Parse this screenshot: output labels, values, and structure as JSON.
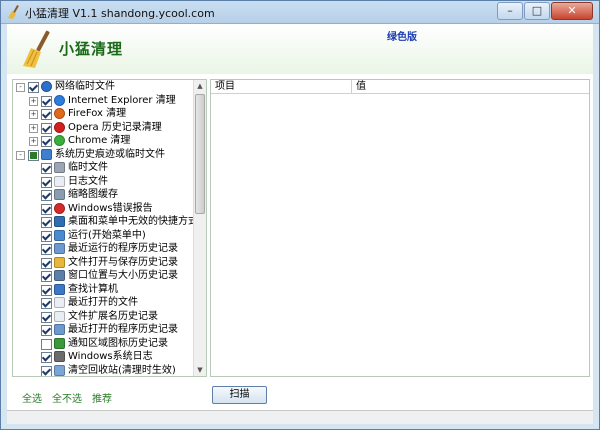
{
  "window": {
    "title": "小猛清理 V1.1 shandong.ycool.com",
    "minimize_label": "–",
    "maximize_label": "□",
    "close_label": "✕"
  },
  "header": {
    "app_name": "小猛清理",
    "edition": "绿色版"
  },
  "tree": {
    "items": [
      {
        "label": "网络临时文件",
        "level": 0,
        "expander": "-",
        "check": "checked",
        "icon": "globe-icon",
        "icon_color": "#2a6fc9"
      },
      {
        "label": "Internet Explorer 清理",
        "level": 1,
        "expander": "+",
        "check": "checked",
        "icon": "ie-icon",
        "icon_color": "#2d7de0"
      },
      {
        "label": "FireFox 清理",
        "level": 1,
        "expander": "+",
        "check": "checked",
        "icon": "firefox-icon",
        "icon_color": "#e06a1a"
      },
      {
        "label": "Opera 历史记录清理",
        "level": 1,
        "expander": "+",
        "check": "checked",
        "icon": "opera-icon",
        "icon_color": "#d22020"
      },
      {
        "label": "Chrome 清理",
        "level": 1,
        "expander": "+",
        "check": "checked",
        "icon": "chrome-icon",
        "icon_color": "#3cae3c"
      },
      {
        "label": "系统历史痕迹或临时文件",
        "level": 0,
        "expander": "-",
        "check": "partial",
        "icon": "windows-icon",
        "icon_color": "#3f7fd0"
      },
      {
        "label": "临时文件",
        "level": 1,
        "expander": "",
        "check": "checked",
        "icon": "file-icon",
        "icon_color": "#9aa6b3"
      },
      {
        "label": "日志文件",
        "level": 1,
        "expander": "",
        "check": "checked",
        "icon": "doc-icon",
        "icon_color": "#e9eef4"
      },
      {
        "label": "缩略图缓存",
        "level": 1,
        "expander": "",
        "check": "checked",
        "icon": "thumbnail-icon",
        "icon_color": "#8a9db0"
      },
      {
        "label": "Windows错误报告",
        "level": 1,
        "expander": "",
        "check": "checked",
        "icon": "error-icon",
        "icon_color": "#d42a2a"
      },
      {
        "label": "桌面和菜单中无效的快捷方式",
        "level": 1,
        "expander": "",
        "check": "checked",
        "icon": "desktop-icon",
        "icon_color": "#2f6fb0"
      },
      {
        "label": "运行(开始菜单中)",
        "level": 1,
        "expander": "",
        "check": "checked",
        "icon": "run-icon",
        "icon_color": "#4a8ad0"
      },
      {
        "label": "最近运行的程序历史记录",
        "level": 1,
        "expander": "",
        "check": "checked",
        "icon": "program-icon",
        "icon_color": "#6a9ad0"
      },
      {
        "label": "文件打开与保存历史记录",
        "level": 1,
        "expander": "",
        "check": "checked",
        "icon": "folder-icon",
        "icon_color": "#e7b73b"
      },
      {
        "label": "窗口位置与大小历史记录",
        "level": 1,
        "expander": "",
        "check": "checked",
        "icon": "window-icon",
        "icon_color": "#5b7fa8"
      },
      {
        "label": "查找计算机",
        "level": 1,
        "expander": "",
        "check": "checked",
        "icon": "search-computer-icon",
        "icon_color": "#3a78c8"
      },
      {
        "label": "最近打开的文件",
        "level": 1,
        "expander": "",
        "check": "checked",
        "icon": "recent-file-icon",
        "icon_color": "#e9eef4"
      },
      {
        "label": "文件扩展名历史记录",
        "level": 1,
        "expander": "",
        "check": "checked",
        "icon": "extension-icon",
        "icon_color": "#e9eef4"
      },
      {
        "label": "最近打开的程序历史记录",
        "level": 1,
        "expander": "",
        "check": "checked",
        "icon": "program-icon",
        "icon_color": "#6a9ad0"
      },
      {
        "label": "通知区域图标历史记录",
        "level": 1,
        "expander": "",
        "check": "unchecked",
        "icon": "tray-icon",
        "icon_color": "#3a9a3a"
      },
      {
        "label": "Windows系统日志",
        "level": 1,
        "expander": "",
        "check": "checked",
        "icon": "log-icon",
        "icon_color": "#6b6b6b"
      },
      {
        "label": "清空回收站(清理时生效)",
        "level": 1,
        "expander": "",
        "check": "checked",
        "icon": "recycle-bin-icon",
        "icon_color": "#7aa6d6"
      }
    ]
  },
  "results": {
    "col_item": "项目",
    "col_value": "值"
  },
  "footer": {
    "select_all": "全选",
    "select_none": "全不选",
    "recommended": "推荐",
    "scan_button": "扫描"
  }
}
